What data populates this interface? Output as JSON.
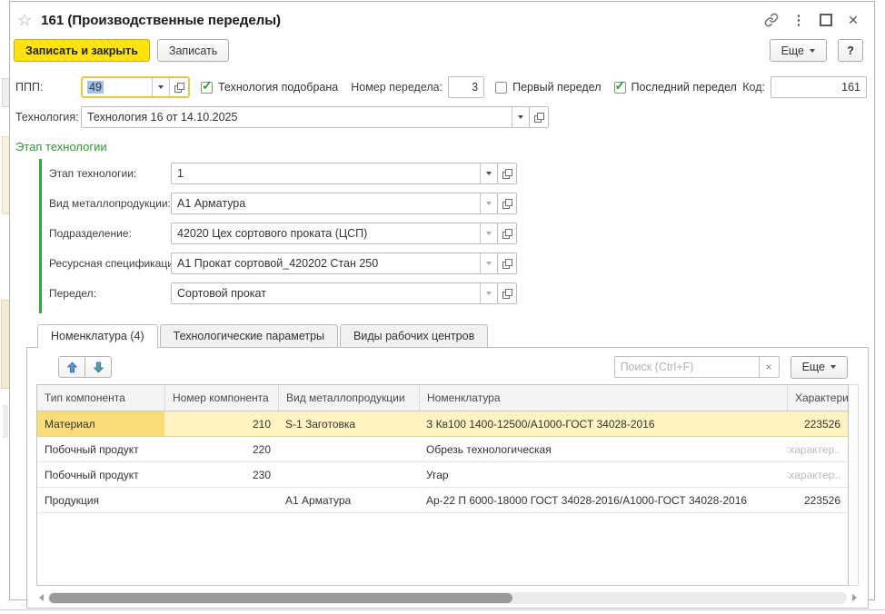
{
  "titlebar": {
    "favorite_icon": "☆",
    "title": "161 (Производственные переделы)",
    "kebab_icon": "⋮",
    "close_icon": "✕"
  },
  "command_bar": {
    "save_and_close": "Записать и закрыть",
    "save": "Записать",
    "more": "Еще",
    "help": "?"
  },
  "fields": {
    "ppp": {
      "label": "ППП:",
      "value": "49"
    },
    "tech_found": {
      "label": "Технология подобрана",
      "checked": true
    },
    "stage_number": {
      "label": "Номер передела:",
      "value": "3"
    },
    "first_stage": {
      "label": "Первый передел",
      "checked": false
    },
    "last_stage": {
      "label": "Последний передел",
      "checked": true
    },
    "code": {
      "label": "Код:",
      "value": "161"
    },
    "technology": {
      "label": "Технология:",
      "value": "Технология 16 от 14.10.2025"
    }
  },
  "stage_group": {
    "title": "Этап технологии",
    "fields": [
      {
        "label": "Этап технологии:",
        "value": "1"
      },
      {
        "label": "Вид металлопродукции:",
        "value": "А1 Арматура"
      },
      {
        "label": "Подразделение:",
        "value": "42020 Цех сортового проката (ЦСП)"
      },
      {
        "label": "Ресурсная спецификация:",
        "value": "А1 Прокат сортовой_420202 Стан 250"
      },
      {
        "label": "Передел:",
        "value": "Сортовой прокат"
      }
    ]
  },
  "tabs": {
    "items": [
      {
        "label": "Номенклатура (4)",
        "active": true
      },
      {
        "label": "Технологические параметры",
        "active": false
      },
      {
        "label": "Виды рабочих центров",
        "active": false
      }
    ]
  },
  "toolbar": {
    "search_placeholder": "Поиск (Ctrl+F)",
    "clear_icon": "×",
    "more": "Еще"
  },
  "table": {
    "columns": [
      "Тип компонента",
      "Номер компонента",
      "Вид металлопродукции",
      "Номенклатура",
      "Характери.."
    ],
    "rows": [
      {
        "type": "Материал",
        "number": "210",
        "metal": "S-1 Заготовка",
        "nomenclature": "З Кв100 1400-12500/А1000-ГОСТ 34028-2016",
        "characteristic": "223526",
        "selected": true,
        "placeholder": false
      },
      {
        "type": "Побочный продукт",
        "number": "220",
        "metal": "",
        "nomenclature": "Обрезь технологическая",
        "characteristic": "<характер..",
        "selected": false,
        "placeholder": true
      },
      {
        "type": "Побочный продукт",
        "number": "230",
        "metal": "",
        "nomenclature": "Угар",
        "characteristic": "<характер..",
        "selected": false,
        "placeholder": true
      },
      {
        "type": "Продукция",
        "number": "",
        "metal": "А1 Арматура",
        "nomenclature": "Ар-22 П 6000-18000 ГОСТ 34028-2016/А1000-ГОСТ 34028-2016",
        "characteristic": "223526",
        "selected": false,
        "placeholder": false
      }
    ]
  },
  "colors": {
    "accent_yellow": "#FFE100",
    "focus_border": "#E9C64A",
    "selection_row": "#FFF3C2",
    "selection_cell": "#F9DC77",
    "group_green": "#2C9A2C",
    "text_selection_blue": "#9DC3EA"
  }
}
